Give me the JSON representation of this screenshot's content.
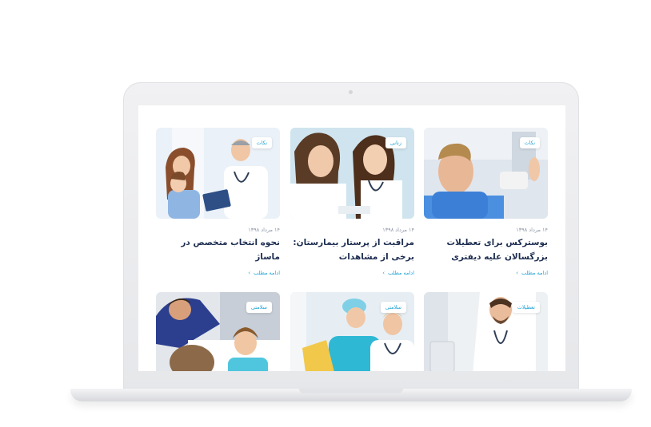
{
  "cards": [
    {
      "tag": "نکات",
      "date": "۱۴ مرداد ۱۳۹۸",
      "title": "بوسترکس برای تعطیلات بزرگسالان علیه دیفتری",
      "more": "ادامه مطلب"
    },
    {
      "tag": "زنانی",
      "date": "۱۴ مرداد ۱۳۹۸",
      "title": "مراقبت از پرستار بیمارستان: برخی از مشاهدات",
      "more": "ادامه مطلب"
    },
    {
      "tag": "نکات",
      "date": "۱۴ مرداد ۱۳۹۸",
      "title": "نحوه انتخاب متخصص در ماساژ",
      "more": "ادامه مطلب"
    },
    {
      "tag": "تعطیلات"
    },
    {
      "tag": "سلامتی"
    },
    {
      "tag": "سلامتی"
    }
  ]
}
